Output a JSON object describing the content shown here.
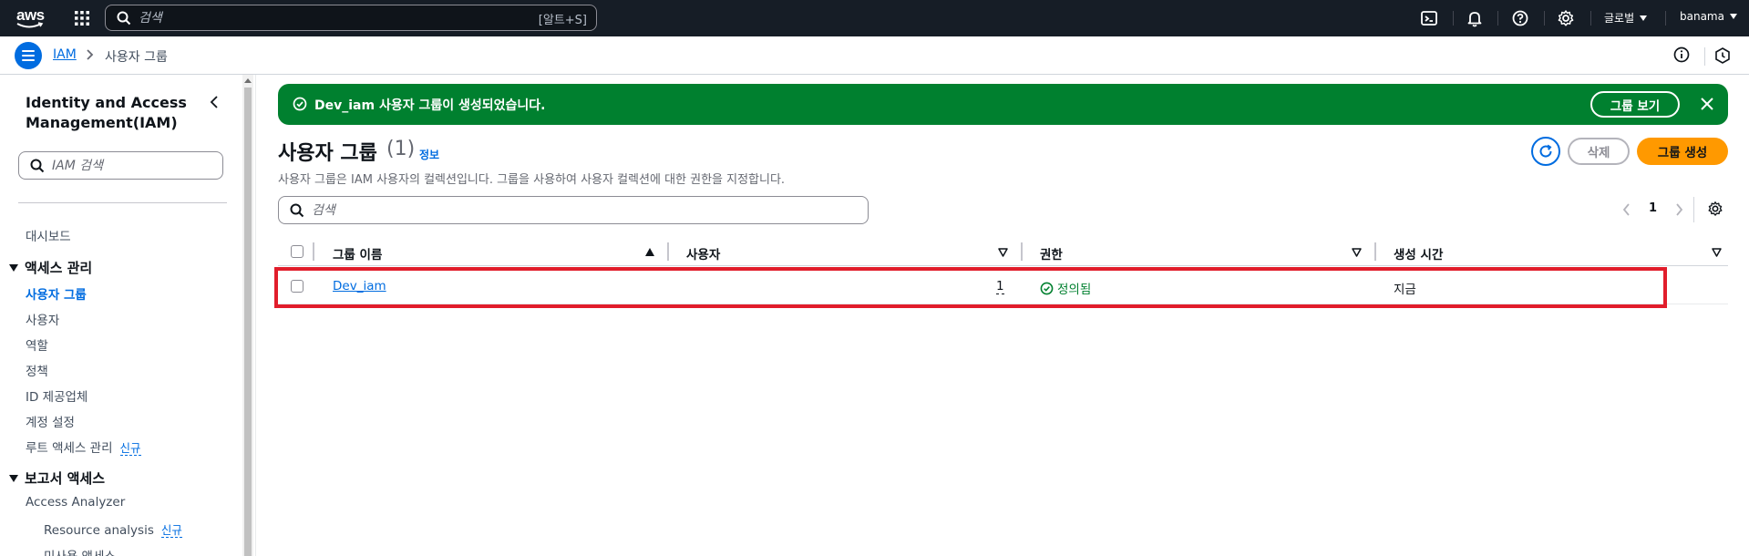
{
  "topbar": {
    "logo_text": "aws",
    "search_placeholder": "검색",
    "search_shortcut": "[알트+S]",
    "region": "글로벌",
    "account": "banama"
  },
  "breadcrumb": {
    "root": "IAM",
    "current": "사용자 그룹"
  },
  "sidebar": {
    "title": "Identity and Access Management(IAM)",
    "search_placeholder": "IAM 검색",
    "dashboard": "대시보드",
    "section_access": "액세스 관리",
    "items": [
      "사용자 그룹",
      "사용자",
      "역할",
      "정책",
      "ID 제공업체",
      "계정 설정",
      "루트 액세스 관리"
    ],
    "new_label": "신규",
    "section_reports": "보고서 액세스",
    "report_items": [
      "Access Analyzer",
      "Resource analysis",
      "미사용 액세스"
    ]
  },
  "flash": {
    "message": "Dev_iam 사용자 그룹이 생성되었습니다.",
    "view_button": "그룹 보기"
  },
  "page": {
    "title": "사용자 그룹",
    "count": "(1)",
    "info": "정보",
    "description": "사용자 그룹은 IAM 사용자의 컬렉션입니다. 그룹을 사용하여 사용자 컬렉션에 대한 권한을 지정합니다.",
    "delete_button": "삭제",
    "create_button": "그룹 생성",
    "table_search_placeholder": "검색",
    "page_number": "1"
  },
  "table": {
    "columns": [
      "그룹 이름",
      "사용자",
      "권한",
      "생성 시간"
    ],
    "rows": [
      {
        "name": "Dev_iam",
        "users": "1",
        "permissions": "정의됨",
        "created": "지금"
      }
    ]
  },
  "colors": {
    "topbar_bg": "#161d26",
    "accent_blue": "#006ce0",
    "success_green": "#00802f",
    "primary_orange": "#ff9900",
    "highlight_red": "#e11d2b"
  }
}
